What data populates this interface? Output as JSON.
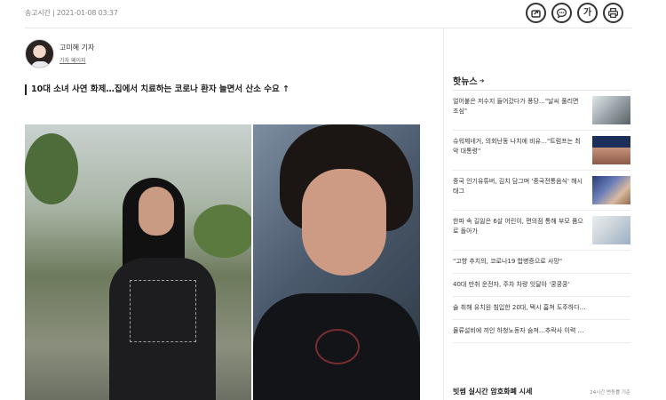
{
  "article": {
    "send_time": "송고시간 | 2021-01-08 03:37",
    "headline": "10대 소녀 사연 화제…집에서 치료하는 코로나 환자 늘면서 산소 수요 ↑"
  },
  "author": {
    "name": "고미혜 기자",
    "page_link": "기자 페이지"
  },
  "toolbar": {
    "share_icon": "share-icon",
    "comment_icon": "comment-icon",
    "font_size_label": "가",
    "print_icon": "print-icon"
  },
  "sidebar": {
    "title": "핫뉴스",
    "title_arrow": "➔",
    "news": [
      {
        "title": "얼어붙은 저수지 들어갔다가 퐁당…\"날씨 풀리면 조심\""
      },
      {
        "title": "슈워제네거, 의회난동 나치에 비유…\"트럼프는 최악 대통령\""
      },
      {
        "title": "중국 인기유튜버, 김치 담그며 '중국전통음식' 해시태그"
      },
      {
        "title": "한파 속 길잃은 6살 어린이, 편의점 통해 부모 품으로 돌아가"
      },
      {
        "title": "\"고향 추치의, 코로나19 합병증으로 사망\""
      },
      {
        "title": "40대 만취 운전자, 주차 차량 잇달아 '쿵쿵쿵'"
      },
      {
        "title": "술 취해 유치원 침입한 20대, 택시 훔쳐 도주하다…"
      },
      {
        "title": "물류설비에 끼인 하청노동자 숨져…추락사 이력 …"
      }
    ],
    "crypto_title": "빗썸 실시간 암호화폐 시세",
    "crypto_note": "24시간 변동률 기준"
  }
}
